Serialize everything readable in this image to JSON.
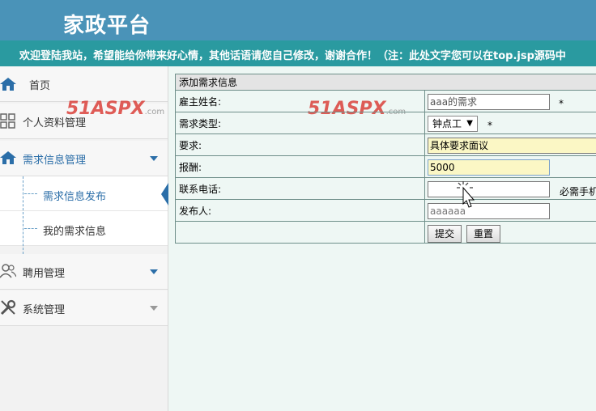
{
  "header": {
    "title": "家政平台"
  },
  "marquee": {
    "text": "欢迎登陆我站，希望能给你带来好心情，其他话语请您自己修改，谢谢合作！（注：此处文字您可以在top.jsp源码中"
  },
  "sidebar": {
    "home": "首页",
    "profile": "个人资料管理",
    "demand": "需求信息管理",
    "demand_publish": "需求信息发布",
    "demand_mine": "我的需求信息",
    "hire": "聘用管理",
    "system": "系统管理"
  },
  "watermark": {
    "brand": "51ASPX",
    "domain": ".com"
  },
  "form": {
    "heading": "添加需求信息",
    "employer_label": "雇主姓名:",
    "employer_value": "aaa的需求",
    "type_label": "需求类型:",
    "type_value": "钟点工",
    "requirement_label": "要求:",
    "requirement_value": "具体要求面议",
    "pay_label": "报酬:",
    "pay_value": "5000",
    "phone_label": "联系电话:",
    "phone_value": "",
    "phone_hint": "必需手机",
    "publisher_label": "发布人:",
    "publisher_value": "aaaaaa",
    "required_mark": "*",
    "submit": "提交",
    "reset": "重置"
  },
  "colors": {
    "header_bg": "#4a93b8",
    "marquee_bg": "#2a9aa0",
    "accent": "#2b6ea8",
    "highlight_field": "#fbf7c5"
  }
}
